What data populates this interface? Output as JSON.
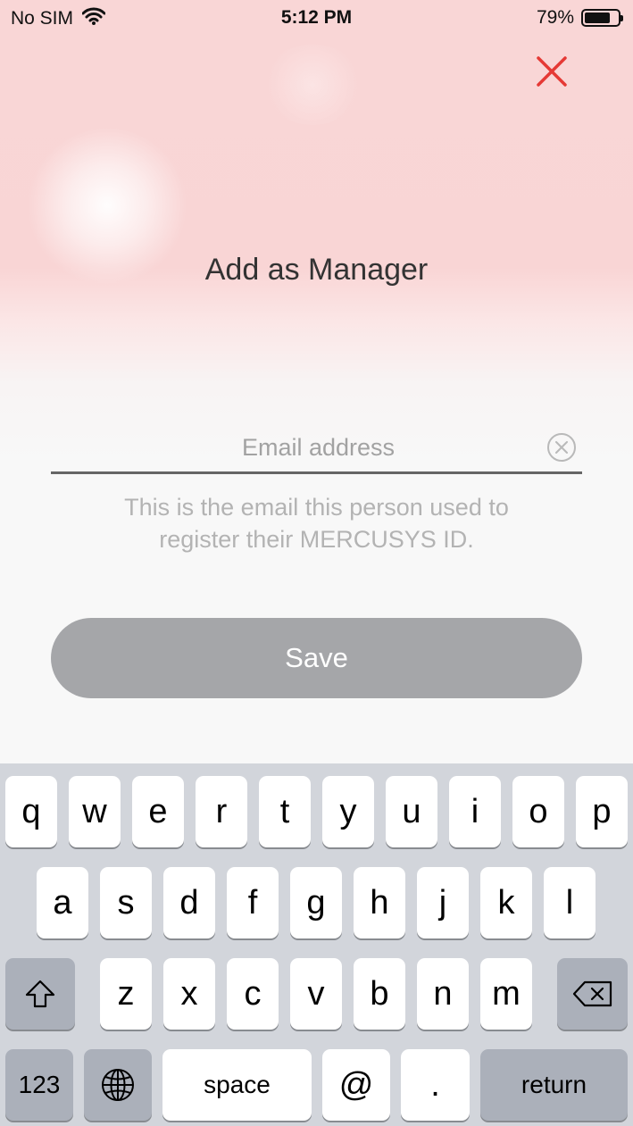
{
  "status_bar": {
    "carrier": "No SIM",
    "time": "5:12 PM",
    "battery_percent": "79%",
    "battery_level": 0.79,
    "wifi_icon": "wifi-icon",
    "battery_icon": "battery-icon"
  },
  "header": {
    "title": "Add as Manager",
    "close_icon": "close-icon",
    "accent_color": "#e53935"
  },
  "form": {
    "email_placeholder": "Email address",
    "email_value": "",
    "clear_icon": "clear-circle-icon",
    "hint_line1": "This is the email this person used to",
    "hint_line2": "register their MERCUSYS ID."
  },
  "save_button": {
    "label": "Save",
    "state": "disabled",
    "color": "#a5a6a9"
  },
  "keyboard": {
    "row1": [
      "q",
      "w",
      "e",
      "r",
      "t",
      "y",
      "u",
      "i",
      "o",
      "p"
    ],
    "row2": [
      "a",
      "s",
      "d",
      "f",
      "g",
      "h",
      "j",
      "k",
      "l"
    ],
    "row3": [
      "z",
      "x",
      "c",
      "v",
      "b",
      "n",
      "m"
    ],
    "shift_icon": "shift-icon",
    "delete_icon": "backspace-icon",
    "globe_icon": "globe-icon",
    "numbers_label": "123",
    "space_label": "space",
    "at_label": "@",
    "dot_label": ".",
    "return_label": "return"
  }
}
